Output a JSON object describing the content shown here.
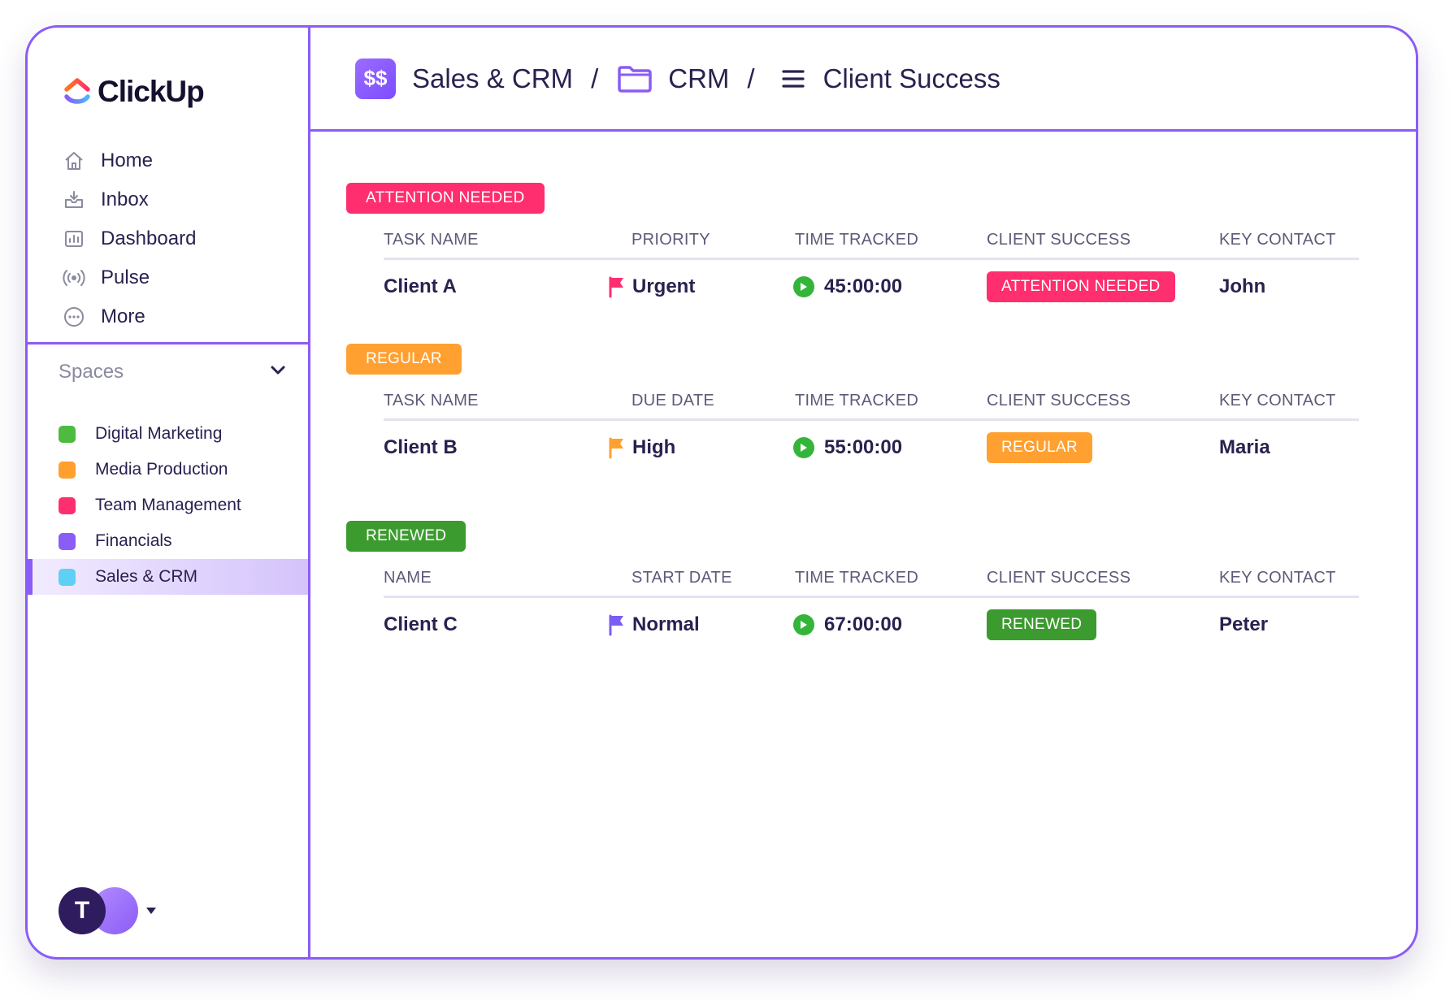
{
  "app": {
    "logo_text": "ClickUp"
  },
  "sidebar": {
    "nav": [
      {
        "label": "Home",
        "icon": "home-icon"
      },
      {
        "label": "Inbox",
        "icon": "inbox-icon"
      },
      {
        "label": "Dashboard",
        "icon": "dashboard-icon"
      },
      {
        "label": "Pulse",
        "icon": "pulse-icon"
      },
      {
        "label": "More",
        "icon": "more-icon"
      }
    ],
    "spaces_label": "Spaces",
    "spaces": [
      {
        "label": "Digital Marketing",
        "color": "#4cbb3f"
      },
      {
        "label": "Media Production",
        "color": "#ff9f2e"
      },
      {
        "label": "Team Management",
        "color": "#ff2e6e"
      },
      {
        "label": "Financials",
        "color": "#8b5cf6"
      },
      {
        "label": "Sales & CRM",
        "color": "#5ed0f5",
        "active": true
      }
    ],
    "avatar_initial": "T"
  },
  "header": {
    "space_icon_text": "$$",
    "breadcrumb": [
      "Sales & CRM",
      "CRM",
      "Client Success"
    ],
    "separator": "/"
  },
  "groups": [
    {
      "tag": "ATTENTION NEEDED",
      "tag_color": "#ff2e6e",
      "columns": [
        "TASK NAME",
        "PRIORITY",
        "TIME TRACKED",
        "CLIENT SUCCESS",
        "KEY CONTACT"
      ],
      "row": {
        "name": "Client A",
        "flag_label": "Urgent",
        "flag_color": "#ff2e6e",
        "time": "45:00:00",
        "status": "ATTENTION NEEDED",
        "status_color": "#ff2e6e",
        "contact": "John"
      }
    },
    {
      "tag": "REGULAR",
      "tag_color": "#ffa030",
      "columns": [
        "TASK NAME",
        "DUE DATE",
        "TIME TRACKED",
        "CLIENT SUCCESS",
        "KEY CONTACT"
      ],
      "row": {
        "name": "Client B",
        "flag_label": "High",
        "flag_color": "#ffa030",
        "time": "55:00:00",
        "status": "REGULAR",
        "status_color": "#ffa030",
        "contact": "Maria"
      }
    },
    {
      "tag": "RENEWED",
      "tag_color": "#3c9b2f",
      "columns": [
        "NAME",
        "START DATE",
        "TIME TRACKED",
        "CLIENT SUCCESS",
        "KEY CONTACT"
      ],
      "row": {
        "name": "Client C",
        "flag_label": "Normal",
        "flag_color": "#7b5cf6",
        "time": "67:00:00",
        "status": "RENEWED",
        "status_color": "#3c9b2f",
        "contact": "Peter"
      }
    }
  ]
}
